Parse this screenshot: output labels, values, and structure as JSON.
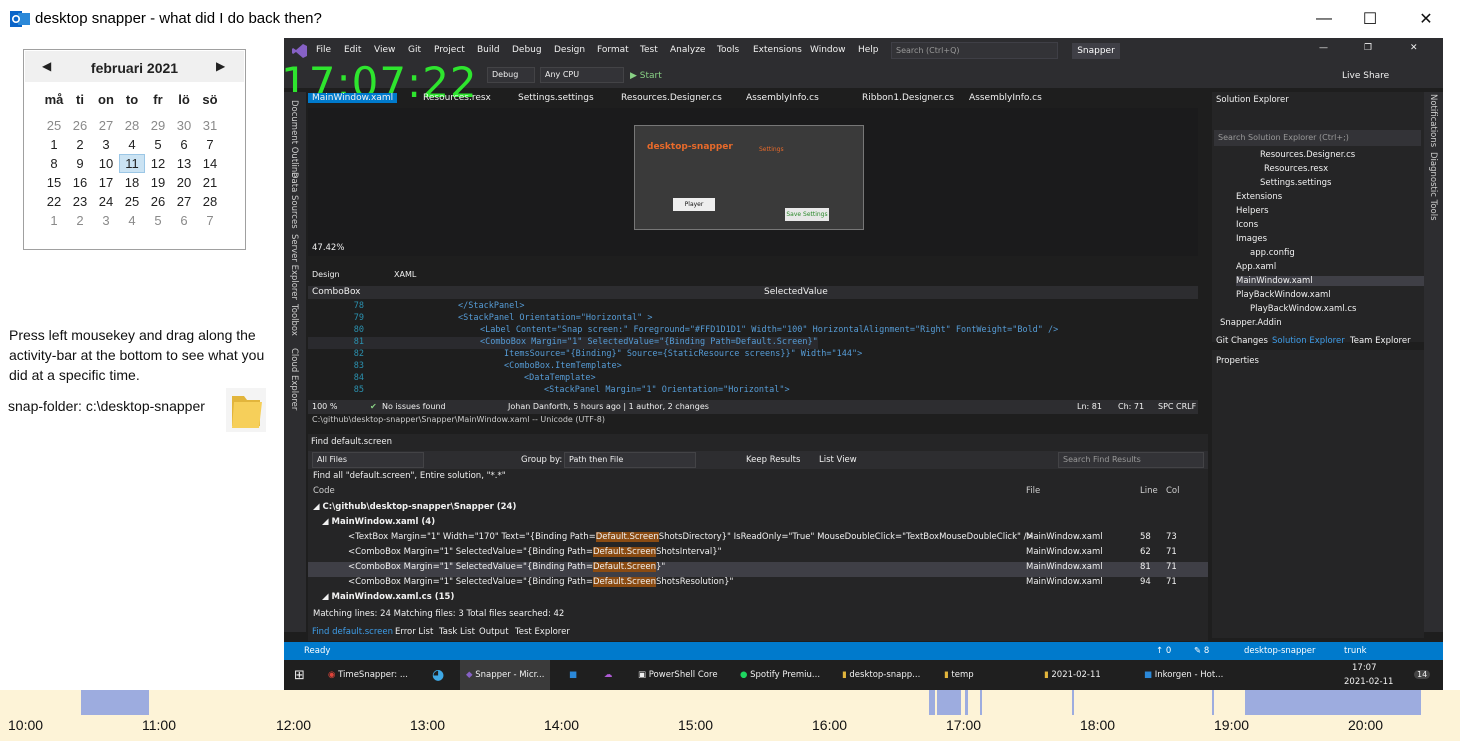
{
  "window": {
    "title": "desktop snapper - what did I do back then?",
    "minimize": "—",
    "maximize": "☐",
    "close": "✕"
  },
  "calendar": {
    "month_label": "februari 2021",
    "prev": "◀",
    "next": "▶",
    "weekdays": [
      "må",
      "ti",
      "on",
      "to",
      "fr",
      "lö",
      "sö"
    ],
    "weeks": [
      [
        "25",
        "26",
        "27",
        "28",
        "29",
        "30",
        "31"
      ],
      [
        "1",
        "2",
        "3",
        "4",
        "5",
        "6",
        "7"
      ],
      [
        "8",
        "9",
        "10",
        "11",
        "12",
        "13",
        "14"
      ],
      [
        "15",
        "16",
        "17",
        "18",
        "19",
        "20",
        "21"
      ],
      [
        "22",
        "23",
        "24",
        "25",
        "26",
        "27",
        "28"
      ],
      [
        "1",
        "2",
        "3",
        "4",
        "5",
        "6",
        "7"
      ]
    ],
    "selected_day": "11"
  },
  "help_text": "Press left mousekey and drag along the activity-bar at the bottom to see what you did at a specific time.",
  "snap_folder_label": "snap-folder: c:\\desktop-snapper",
  "screenshot": {
    "clock": "17:07:22",
    "menu": [
      "File",
      "Edit",
      "View",
      "Git",
      "Project",
      "Build",
      "Debug",
      "Design",
      "Format",
      "Test",
      "Analyze",
      "Tools",
      "Extensions",
      "Window",
      "Help"
    ],
    "search_placeholder": "Search (Ctrl+Q)",
    "solution_name": "Snapper",
    "live_share": "Live Share",
    "toolbar": {
      "config": "Debug",
      "platform": "Any CPU",
      "start": "▶ Start"
    },
    "tabs": [
      "MainWindow.xaml",
      "Resources.resx",
      "Settings.settings",
      "Resources.Designer.cs",
      "AssemblyInfo.cs",
      "Ribbon1.Designer.cs",
      "AssemblyInfo.cs"
    ],
    "designer": {
      "app_title": "desktop-snapper",
      "settings_title": "Settings",
      "player_button": "Player",
      "save_button": "Save Settings",
      "zoom": "47.42%",
      "design_tab": "Design",
      "xaml_tab": "XAML"
    },
    "code_header": {
      "left": "ComboBox",
      "right": "SelectedValue"
    },
    "code_lines": [
      {
        "n": "78",
        "t": "</StackPanel>"
      },
      {
        "n": "79",
        "t": "<StackPanel Orientation=\"Horizontal\" >"
      },
      {
        "n": "80",
        "t": "<Label Content=\"Snap screen:\" Foreground=\"#FFD1D1D1\" Width=\"100\" HorizontalAlignment=\"Right\" FontWeight=\"Bold\" />"
      },
      {
        "n": "81",
        "t": "<ComboBox Margin=\"1\" SelectedValue=\"{Binding Path=Default.Screen}\""
      },
      {
        "n": "82",
        "t": "ItemsSource=\"{Binding}\" Source={StaticResource screens}}\" Width=\"144\">"
      },
      {
        "n": "83",
        "t": "<ComboBox.ItemTemplate>"
      },
      {
        "n": "84",
        "t": "<DataTemplate>"
      },
      {
        "n": "85",
        "t": "<StackPanel Margin=\"1\" Orientation=\"Horizontal\">"
      }
    ],
    "editor_status": {
      "zoom": "100 %",
      "issues": "No issues found",
      "author": "Johan Danforth, 5 hours ago | 1 author, 2 changes",
      "ln": "Ln: 81",
      "ch": "Ch: 71",
      "spc": "SPC",
      "crlf": "CRLF"
    },
    "file_path": "C:\\github\\desktop-snapper\\Snapper\\MainWindow.xaml -- Unicode (UTF-8)",
    "find": {
      "title": "Find default.screen",
      "scope": "All Files",
      "group_by_label": "Group by:",
      "group_by_value": "Path then File",
      "keep_results": "Keep Results",
      "list_view": "List View",
      "search_placeholder": "Search Find Results",
      "summary": "Find all \"default.screen\", Entire solution, \"*.*\"",
      "headers": {
        "code": "Code",
        "file": "File",
        "line": "Line",
        "col": "Col"
      },
      "group1": "C:\\github\\desktop-snapper\\Snapper (24)",
      "group2": "MainWindow.xaml (4)",
      "rows": [
        {
          "pre": "<TextBox Margin=\"1\" Width=\"170\" Text=\"{Binding Path=",
          "hl": "Default.Screen",
          "post": "ShotsDirectory}\" IsReadOnly=\"True\" MouseDoubleClick=\"TextBoxMouseDoubleClick\" />",
          "file": "MainWindow.xaml",
          "line": "58",
          "col": "73"
        },
        {
          "pre": "<ComboBox Margin=\"1\" SelectedValue=\"{Binding Path=",
          "hl": "Default.Screen",
          "post": "ShotsInterval}\"",
          "file": "MainWindow.xaml",
          "line": "62",
          "col": "71"
        },
        {
          "pre": "<ComboBox Margin=\"1\" SelectedValue=\"{Binding Path=",
          "hl": "Default.Screen",
          "post": "}\"",
          "file": "MainWindow.xaml",
          "line": "81",
          "col": "71"
        },
        {
          "pre": "<ComboBox Margin=\"1\" SelectedValue=\"{Binding Path=",
          "hl": "Default.Screen",
          "post": "ShotsResolution}\"",
          "file": "MainWindow.xaml",
          "line": "94",
          "col": "71"
        }
      ],
      "group3": "MainWindow.xaml.cs (15)",
      "matching": "Matching lines: 24 Matching files: 3 Total files searched: 42",
      "footer_tabs": [
        "Find default.screen",
        "Error List",
        "Task List",
        "Output",
        "Test Explorer"
      ]
    },
    "solution_explorer": {
      "title": "Solution Explorer",
      "search_placeholder": "Search Solution Explorer (Ctrl+;)",
      "items": [
        "Resources.Designer.cs",
        "Resources.resx",
        "Settings.settings",
        "Extensions",
        "Helpers",
        "Icons",
        "Images",
        "app.config",
        "App.xaml",
        "MainWindow.xaml",
        "PlayBackWindow.xaml",
        "PlayBackWindow.xaml.cs",
        "Snapper.Addin"
      ],
      "selected": "MainWindow.xaml",
      "tabs": [
        "Git Changes",
        "Solution Explorer",
        "Team Explorer"
      ],
      "properties_title": "Properties"
    },
    "left_rail": [
      "Document Outline",
      "Data Sources",
      "Server Explorer",
      "Toolbox",
      "Cloud Explorer"
    ],
    "right_rail": [
      "Notifications",
      "Diagnostic Tools"
    ],
    "status": {
      "ready": "Ready",
      "up": "↑ 0",
      "pencil": "✎ 8",
      "repo": "desktop-snapper",
      "branch": "trunk"
    },
    "taskbar": {
      "items": [
        "TimeSnapper: ...",
        "Snapper - Micr...",
        "PowerShell Core",
        "Spotify Premiu...",
        "desktop-snapp...",
        "temp",
        "2021-02-11",
        "Inkorgen - Hot..."
      ],
      "time": "17:07",
      "date": "2021-02-11",
      "badge": "14"
    }
  },
  "activity_bar": {
    "hours": [
      "10:00",
      "11:00",
      "12:00",
      "13:00",
      "14:00",
      "15:00",
      "16:00",
      "17:00",
      "18:00",
      "19:00",
      "20:00"
    ],
    "color": "#9dacdf",
    "background": "#fdf3d7"
  }
}
